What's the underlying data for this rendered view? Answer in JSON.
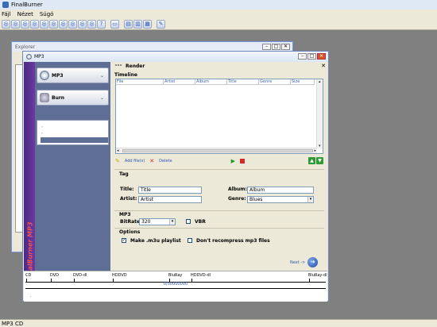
{
  "app": {
    "title": "FinalBurner",
    "menu": [
      "Fájl",
      "Nézet",
      "Súgó"
    ],
    "status": "MP3 CD"
  },
  "explorer": {
    "title": "Explorer"
  },
  "mp3window": {
    "title": "MP3",
    "nav": {
      "items": [
        {
          "label": "MP3",
          "icon": "disc-icon"
        },
        {
          "label": "Burn",
          "icon": "burn-icon"
        }
      ],
      "panel_lines": [
        ",",
        ","
      ],
      "vertical_text": "FinalBurner MP3"
    },
    "render": {
      "header": "Render",
      "timeline": {
        "label": "Timeline",
        "columns": [
          "File",
          "Artist",
          "Album",
          "Title",
          "Genre",
          "Size"
        ]
      },
      "actions": {
        "add_label": "Add file(s)",
        "delete_label": "Delete"
      },
      "tag": {
        "label": "Tag",
        "title_label": "Title:",
        "title_value": "Title",
        "artist_label": "Artist:",
        "artist_value": "Artist",
        "album_label": "Album:",
        "album_value": "Album",
        "genre_label": "Genre:",
        "genre_value": "Blues"
      },
      "mp3": {
        "label": "MP3",
        "bitrate_label": "BitRate",
        "bitrate_value": "320",
        "vbr_label": "VBR",
        "vbr_checked": false
      },
      "options": {
        "label": "Options",
        "playlist_label": "Make .m3u playlist",
        "playlist_checked": true,
        "norecompress_label": "Don't recompress mp3 files",
        "norecompress_checked": false
      },
      "next_label": "Next ->"
    },
    "capacity": {
      "ticks": [
        "CD",
        "DVD",
        "DVD-dl",
        "HDDVD",
        "BluRay",
        "HDDVD-dl",
        "BluRay-dl"
      ],
      "progress_text": "0/50000000",
      "marker": "."
    }
  },
  "colors": {
    "accent": "#2c56b0",
    "nav_bg": "#5f6e94",
    "close": "#d9512c"
  }
}
